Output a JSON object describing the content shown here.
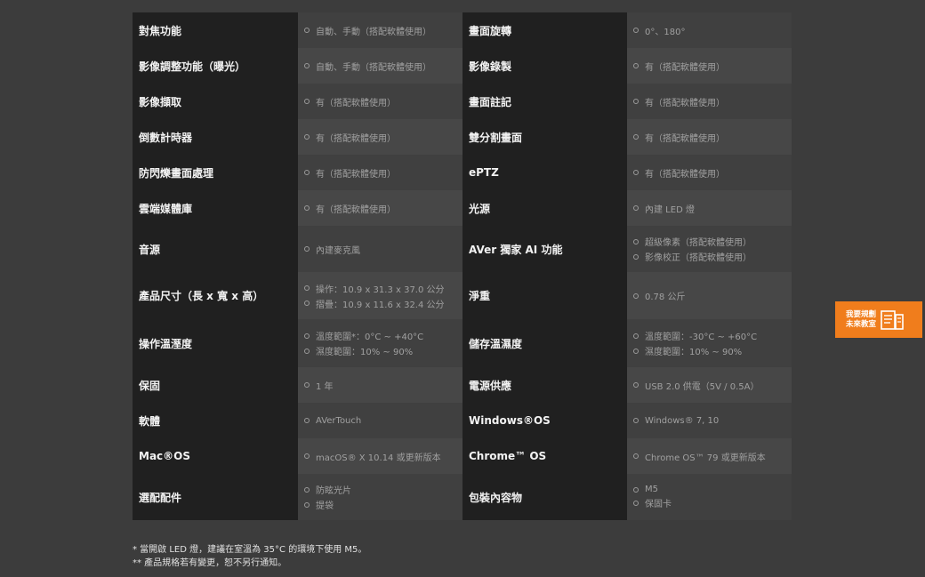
{
  "rows": [
    {
      "h": 40,
      "k1": "對焦功能",
      "v1": [
        "自動、手動（搭配軟體使用）"
      ],
      "k2": "畫面旋轉",
      "v2": [
        "0°、180°"
      ]
    },
    {
      "h": 40,
      "k1": "影像調整功能（曝光）",
      "v1": [
        "自動、手動（搭配軟體使用）"
      ],
      "k2": "影像錄製",
      "v2": [
        "有（搭配軟體使用）"
      ]
    },
    {
      "h": 40,
      "k1": "影像擷取",
      "v1": [
        "有（搭配軟體使用）"
      ],
      "k2": "畫面註記",
      "v2": [
        "有（搭配軟體使用）"
      ]
    },
    {
      "h": 40,
      "k1": "倒數計時器",
      "v1": [
        "有（搭配軟體使用）"
      ],
      "k2": "雙分割畫面",
      "v2": [
        "有（搭配軟體使用）"
      ]
    },
    {
      "h": 40,
      "k1": "防閃爍畫面處理",
      "v1": [
        "有（搭配軟體使用）"
      ],
      "k2": "ePTZ",
      "v2": [
        "有（搭配軟體使用）"
      ]
    },
    {
      "h": 40,
      "k1": "雲端媒體庫",
      "v1": [
        "有（搭配軟體使用）"
      ],
      "k2": "光源",
      "v2": [
        "內建 LED 燈"
      ]
    },
    {
      "h": 52,
      "k1": "音源",
      "v1": [
        "內建麥克風"
      ],
      "k2": "AVer 獨家 AI 功能",
      "v2": [
        "超級像素（搭配軟體使用）",
        "影像校正（搭配軟體使用）"
      ]
    },
    {
      "h": 53,
      "k1": "產品尺寸（長 x 寬 x 高）",
      "v1": [
        "操作：10.9 x 31.3 x 37.0 公分",
        "摺疊：10.9 x 11.6 x 32.4 公分"
      ],
      "k2": "淨重",
      "v2": [
        "0.78 公斤"
      ]
    },
    {
      "h": 54,
      "k1": "操作溫溼度",
      "v1": [
        "溫度範圍*：0°C ~ +40°C",
        "濕度範圍：10% ~ 90%"
      ],
      "k2": "儲存溫濕度",
      "v2": [
        "溫度範圍：-30°C ~ +60°C",
        "濕度範圍：10% ~ 90%"
      ]
    },
    {
      "h": 40,
      "k1": "保固",
      "v1": [
        "1 年"
      ],
      "k2": "電源供應",
      "v2": [
        "USB 2.0 供電（5V / 0.5A）"
      ]
    },
    {
      "h": 40,
      "k1": "軟體",
      "v1": [
        "AVerTouch"
      ],
      "k2": "Windows®OS",
      "v2": [
        "Windows® 7, 10"
      ]
    },
    {
      "h": 40,
      "k1": "Mac®OS",
      "v1": [
        "macOS® X 10.14 或更新版本"
      ],
      "k2": "Chrome™ OS",
      "v2": [
        "Chrome OS™ 79 或更新版本"
      ]
    },
    {
      "h": 52,
      "k1": "選配配件",
      "v1": [
        "防眩光片",
        "提袋"
      ],
      "k2": "包裝內容物",
      "v2": [
        "M5",
        "保固卡"
      ]
    }
  ],
  "notes": [
    "* 當開啟 LED 燈，建議在室溫為 35°C 的環境下使用 M5。",
    "** 產品規格若有變更，恕不另行通知。"
  ],
  "side_tab": {
    "line1": "我要規劃",
    "line2": "未來教室",
    "icon": "document-plan-icon"
  },
  "colors": {
    "accent": "#f07d1c",
    "key_bg": "#202020",
    "page_bg": "#3c3c3c"
  }
}
